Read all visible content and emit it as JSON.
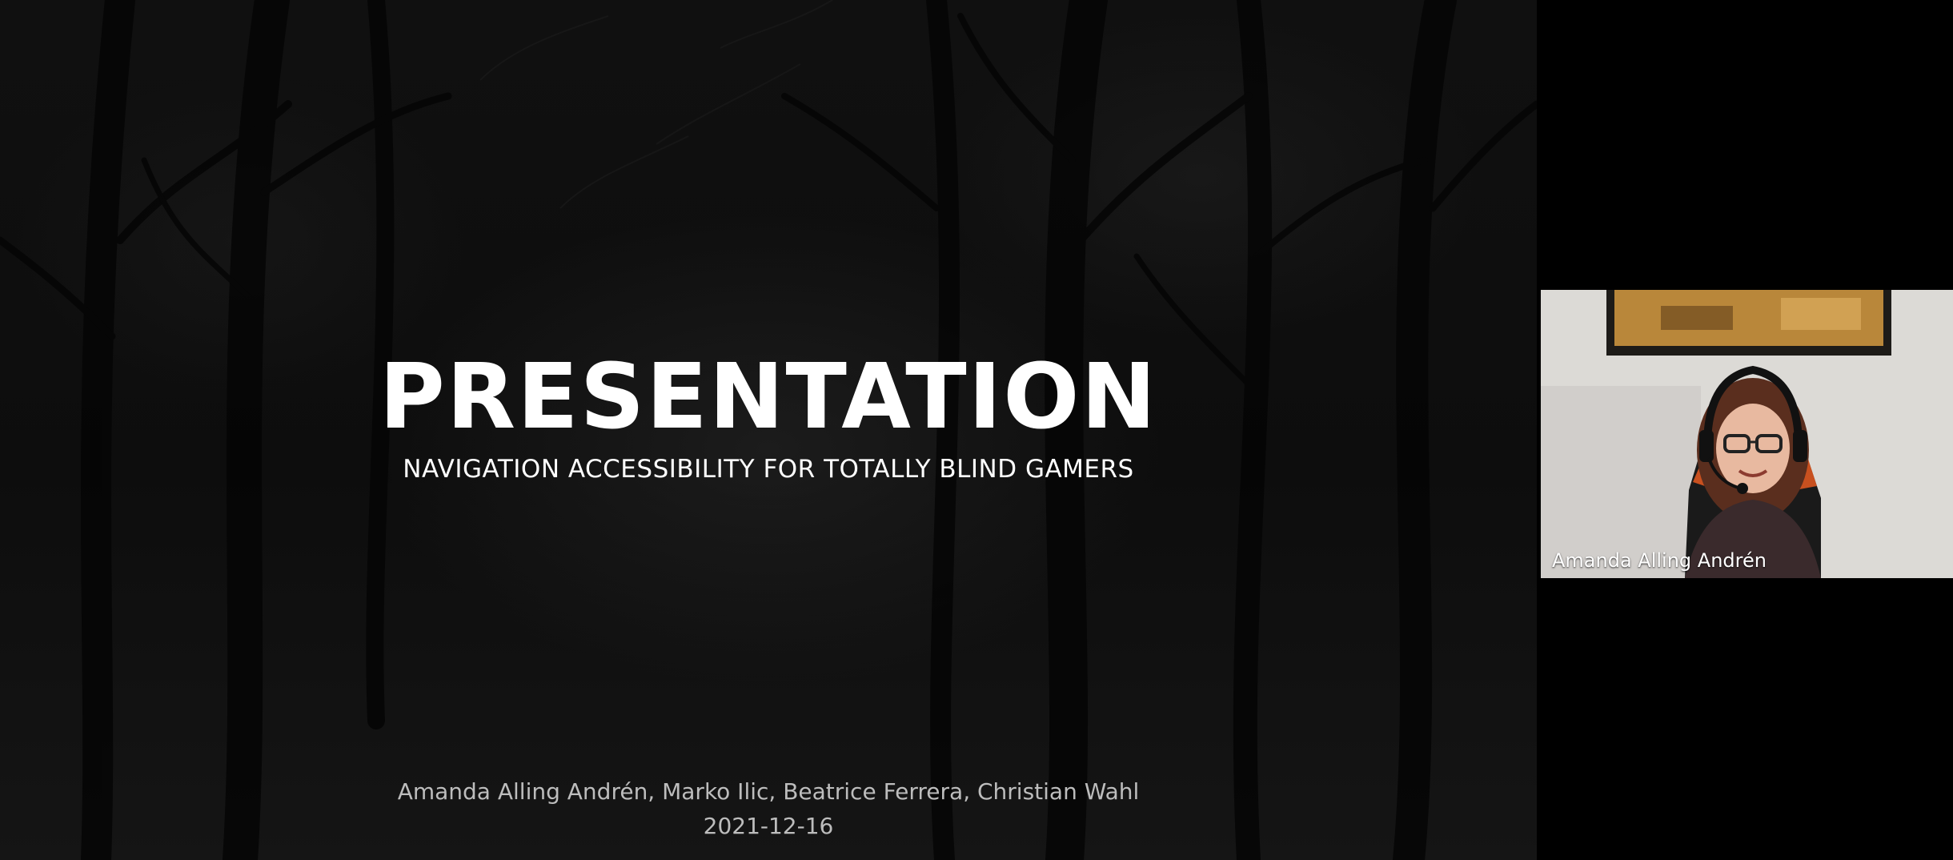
{
  "slide": {
    "title": "PRESENTATION",
    "subtitle": "NAVIGATION ACCESSIBILITY FOR TOTALLY BLIND GAMERS",
    "authors": "Amanda Alling Andrén, Marko Ilic, Beatrice Ferrera, Christian Wahl",
    "date": "2021-12-16"
  },
  "participant": {
    "name": "Amanda Alling Andrén"
  },
  "colors": {
    "background": "#000000",
    "title_text": "#ffffff",
    "footer_text": "#bdbdbd"
  }
}
